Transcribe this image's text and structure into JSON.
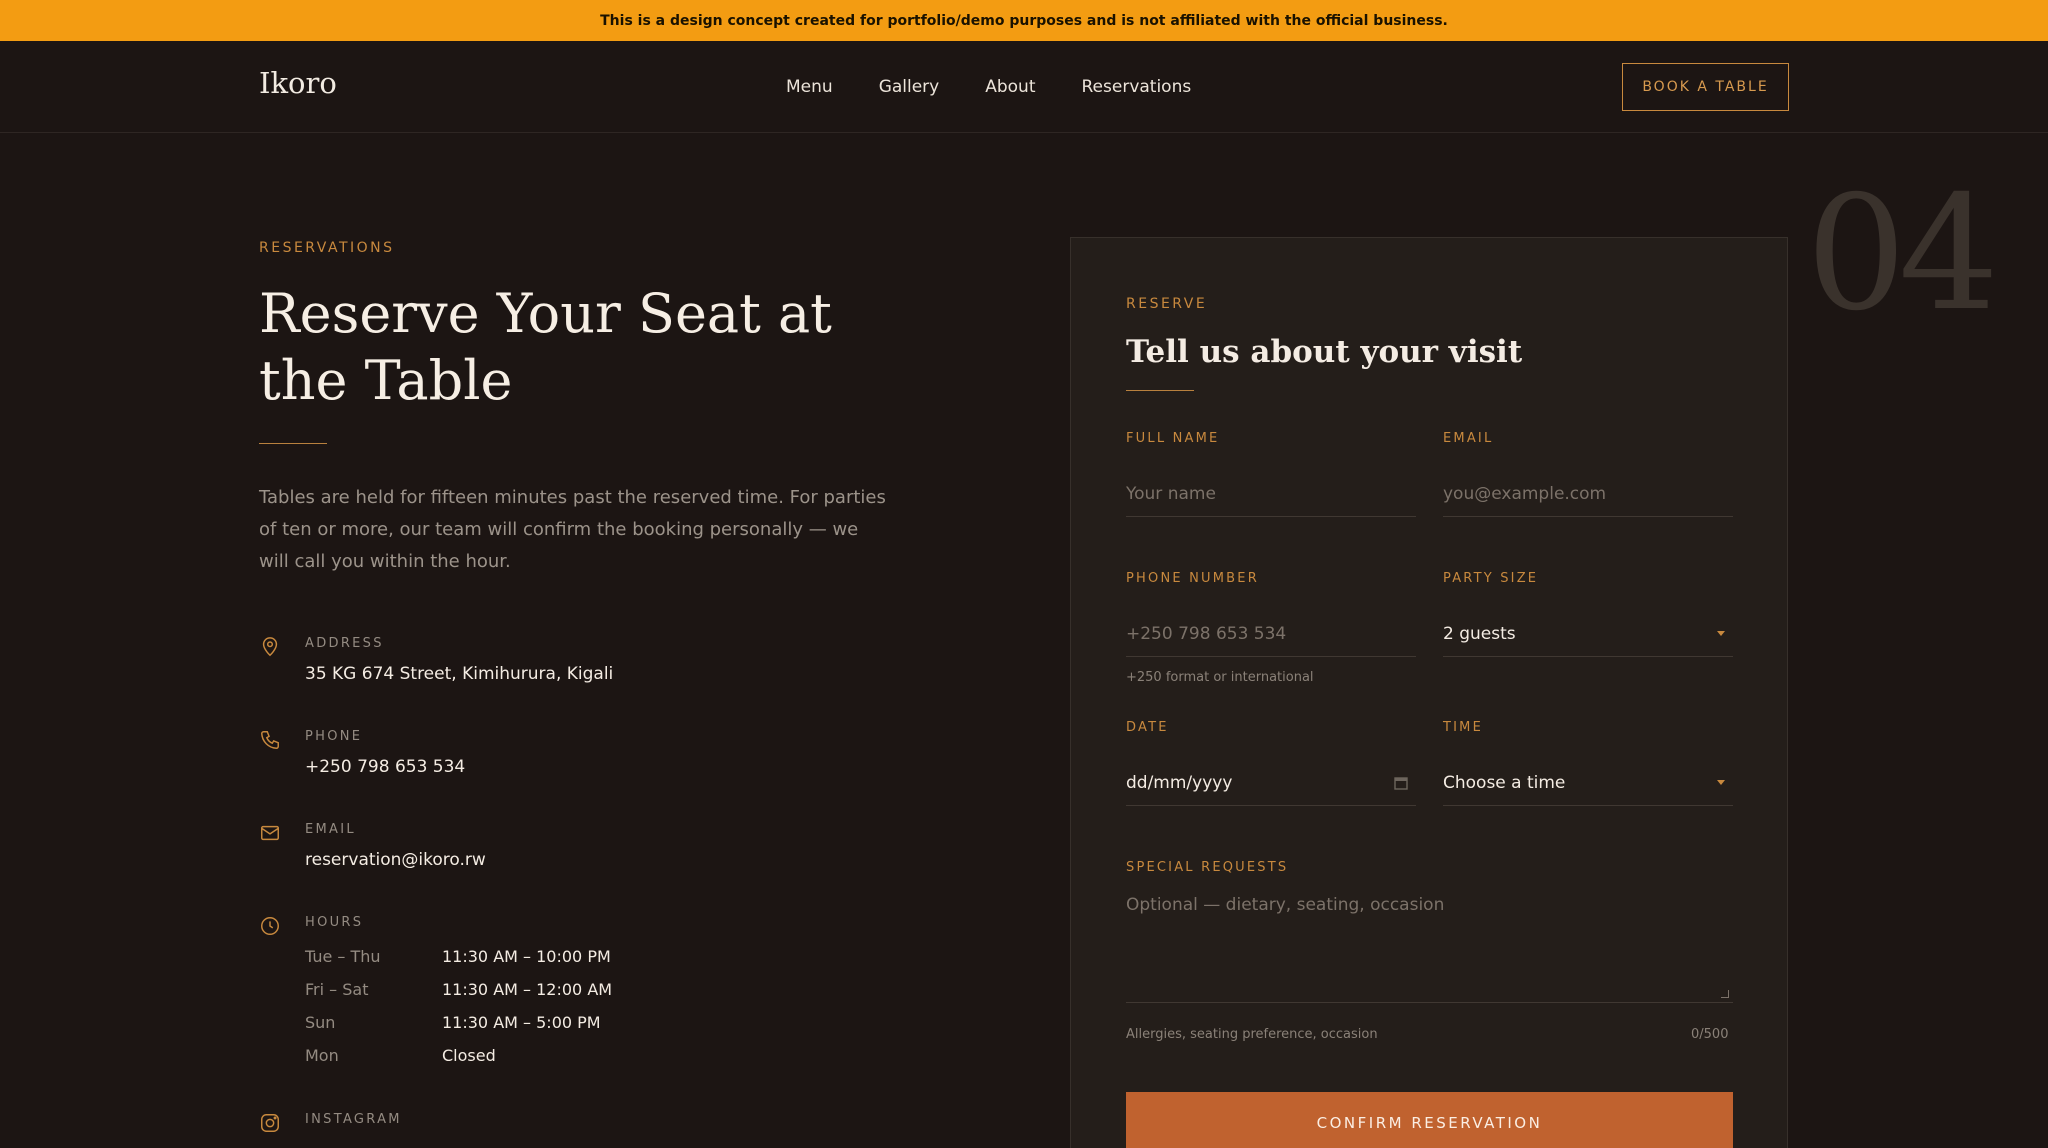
{
  "banner": {
    "text": "This is a design concept created for portfolio/demo purposes and is not affiliated with the official business."
  },
  "nav": {
    "logo": "Ikoro",
    "links": [
      "Menu",
      "Gallery",
      "About",
      "Reservations"
    ],
    "cta": "BOOK A TABLE"
  },
  "hero": {
    "eyebrow": "RESERVATIONS",
    "title": "Reserve Your Seat at the Table",
    "intro": "Tables are held for fifteen minutes past the reserved time. For parties of ten or more, our team will confirm the booking personally — we will call you within the hour."
  },
  "info": {
    "address": {
      "label": "ADDRESS",
      "value": "35 KG 674 Street, Kimihurura, Kigali",
      "icon": "map-pin-icon"
    },
    "phone": {
      "label": "PHONE",
      "value": "+250 798 653 534",
      "icon": "phone-icon"
    },
    "email": {
      "label": "EMAIL",
      "value": "reservation@ikoro.rw",
      "icon": "mail-icon"
    },
    "hours": {
      "label": "HOURS",
      "icon": "clock-icon",
      "rows": [
        {
          "day": "Tue – Thu",
          "time": "11:30 AM – 10:00 PM"
        },
        {
          "day": "Fri – Sat",
          "time": "11:30 AM – 12:00 AM"
        },
        {
          "day": "Sun",
          "time": "11:30 AM – 5:00 PM"
        },
        {
          "day": "Mon",
          "time": "Closed"
        }
      ]
    },
    "instagram": {
      "label": "INSTAGRAM",
      "icon": "instagram-icon"
    }
  },
  "decor": {
    "section_number": "04"
  },
  "form": {
    "eyebrow": "RESERVE",
    "title": "Tell us about your visit",
    "full_name": {
      "label": "FULL NAME",
      "placeholder": "Your name"
    },
    "email": {
      "label": "EMAIL",
      "placeholder": "you@example.com"
    },
    "phone": {
      "label": "PHONE NUMBER",
      "placeholder": "+250 798 653 534",
      "hint": "+250 format or international"
    },
    "party_size": {
      "label": "PARTY SIZE",
      "value": "2 guests"
    },
    "date": {
      "label": "DATE",
      "placeholder": "dd/mm/yyyy"
    },
    "time": {
      "label": "TIME",
      "value": "Choose a time"
    },
    "special": {
      "label": "SPECIAL REQUESTS",
      "placeholder": "Optional — dietary, seating, occasion",
      "hint": "Allergies, seating preference, occasion",
      "counter": "0/500"
    },
    "submit": "CONFIRM RESERVATION"
  },
  "colors": {
    "accent": "#c8893e",
    "button": "#c0622f",
    "banner": "#f39c12",
    "background": "#1c1513",
    "card": "#241e1a"
  }
}
